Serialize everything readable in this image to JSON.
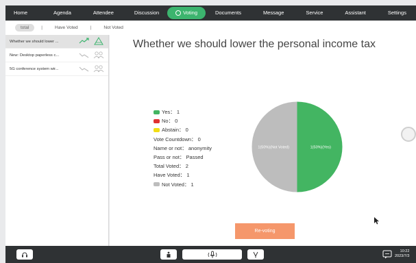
{
  "nav": {
    "items": [
      {
        "label": "Home",
        "active": false
      },
      {
        "label": "Agenda",
        "active": false
      },
      {
        "label": "Attendee",
        "active": false
      },
      {
        "label": "Discussion",
        "active": false
      },
      {
        "label": "Voting",
        "active": true
      },
      {
        "label": "Documents",
        "active": false
      },
      {
        "label": "Message",
        "active": false
      },
      {
        "label": "Service",
        "active": false
      },
      {
        "label": "Assistant",
        "active": false
      },
      {
        "label": "Settings",
        "active": false
      }
    ]
  },
  "filters": {
    "total": "total",
    "have_voted": "Have Voted",
    "not_voted": "Not Voted",
    "separator": "|"
  },
  "sidebar": {
    "items": [
      {
        "label": "Whether we should lower ...",
        "selected": true
      },
      {
        "label": "New: Desktop paperless c...",
        "selected": false
      },
      {
        "label": "5G conference system wir...",
        "selected": false
      }
    ]
  },
  "vote": {
    "title": "Whether we should lower the personal income tax",
    "yes": "Yes： 1",
    "no": "No： 0",
    "abstain": "Abstain： 0",
    "countdown": "Vote Countdown： 0",
    "name_or_not": "Name or not： anonymity",
    "pass_or_not": "Pass or not： Passed",
    "total_voted": "Total Voted： 2",
    "have_voted": "Have Voted： 1",
    "not_voted": "Not Voted： 1",
    "revote_label": "Re-voting"
  },
  "chart_data": {
    "type": "pie",
    "slices": [
      {
        "label": "1(50%)(Yes)",
        "value": 1,
        "color": "#43b562"
      },
      {
        "label": "1(50%)(Not Voted)",
        "value": 1,
        "color": "#bdbdbd"
      }
    ]
  },
  "colors": {
    "yes": "#43b562",
    "no": "#e03131",
    "abstain": "#f2dd14",
    "not_voted": "#bdbdbd",
    "accent": "#3cb46e",
    "revote": "#f5976b"
  },
  "status": {
    "time": "10:22",
    "date": "2023/7/3"
  },
  "icons": {
    "headset": "headset-icon",
    "podium": "podium-icon",
    "mic": "microphone-icon",
    "interpretation": "interpreter-icon",
    "chat": "chat-icon",
    "vote": "voting-icon"
  }
}
